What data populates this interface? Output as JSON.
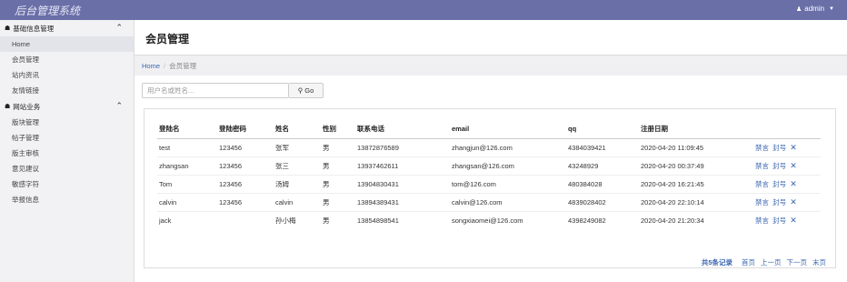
{
  "app": {
    "title": "后台管理系统",
    "user": "admin"
  },
  "sidebar": {
    "groups": [
      {
        "label": "基础信息管理",
        "items": [
          "Home",
          "会员管理",
          "站内资讯",
          "友情链接"
        ]
      },
      {
        "label": "网站业务",
        "items": [
          "版块管理",
          "帖子管理",
          "版主审核",
          "意见建议",
          "敏感字符",
          "举报信息"
        ]
      }
    ]
  },
  "page": {
    "title": "会员管理"
  },
  "breadcrumb": {
    "home": "Home",
    "separator": "/",
    "current": "会员管理"
  },
  "search": {
    "placeholder": "用户名或姓名...",
    "button_label": "Go"
  },
  "table": {
    "columns": [
      "登陆名",
      "登陆密码",
      "姓名",
      "性别",
      "联系电话",
      "email",
      "qq",
      "注册日期",
      ""
    ],
    "rows": [
      {
        "login": "test",
        "password": "123456",
        "name": "张军",
        "gender": "男",
        "phone": "13872876589",
        "email": "zhangjun@126.com",
        "qq": "4384039421",
        "date": "2020-04-20 11:09:45"
      },
      {
        "login": "zhangsan",
        "password": "123456",
        "name": "张三",
        "gender": "男",
        "phone": "13937462611",
        "email": "zhangsan@126.com",
        "qq": "43248929",
        "date": "2020-04-20 00:37:49"
      },
      {
        "login": "Tom",
        "password": "123456",
        "name": "汤姆",
        "gender": "男",
        "phone": "13904830431",
        "email": "tom@126.com",
        "qq": "480384028",
        "date": "2020-04-20 16:21:45"
      },
      {
        "login": "calvin",
        "password": "123456",
        "name": "calvin",
        "gender": "男",
        "phone": "13894389431",
        "email": "calvin@126.com",
        "qq": "4839028402",
        "date": "2020-04-20 22:10:14"
      },
      {
        "login": "jack",
        "password": "",
        "name": "孙小梅",
        "gender": "男",
        "phone": "13854898541",
        "email": "songxiaomei@126.com",
        "qq": "4398249082",
        "date": "2020-04-20 21:20:34"
      }
    ],
    "actions": {
      "mute": "禁言",
      "ban": "封号",
      "delete": "✕"
    }
  },
  "pager": {
    "total": "共5条记录",
    "first": "首页",
    "prev": "上一页",
    "next": "下一页",
    "last": "末页"
  },
  "colors": {
    "topbar": "#6a6fa8",
    "link": "#3a66b0",
    "sidebar_bg": "#f2f2f5"
  }
}
